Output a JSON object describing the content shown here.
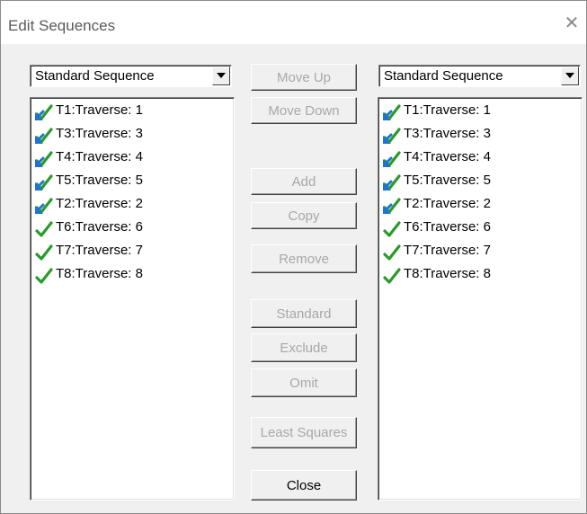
{
  "window": {
    "title": "Edit Sequences"
  },
  "left_combo": {
    "value": "Standard Sequence"
  },
  "right_combo": {
    "value": "Standard Sequence"
  },
  "left_list": [
    {
      "label": "T1:Traverse: 1",
      "icon": "blue-arrow-check-icon"
    },
    {
      "label": "T3:Traverse: 3",
      "icon": "blue-arrow-check-icon"
    },
    {
      "label": "T4:Traverse: 4",
      "icon": "blue-arrow-check-icon"
    },
    {
      "label": "T5:Traverse: 5",
      "icon": "blue-arrow-check-icon"
    },
    {
      "label": "T2:Traverse: 2",
      "icon": "blue-arrow-check-icon"
    },
    {
      "label": "T6:Traverse: 6",
      "icon": "green-check-icon"
    },
    {
      "label": "T7:Traverse: 7",
      "icon": "green-check-icon"
    },
    {
      "label": "T8:Traverse: 8",
      "icon": "green-check-icon"
    }
  ],
  "right_list": [
    {
      "label": "T1:Traverse: 1",
      "icon": "blue-arrow-check-icon"
    },
    {
      "label": "T3:Traverse: 3",
      "icon": "blue-arrow-check-icon"
    },
    {
      "label": "T4:Traverse: 4",
      "icon": "blue-arrow-check-icon"
    },
    {
      "label": "T5:Traverse: 5",
      "icon": "blue-arrow-check-icon"
    },
    {
      "label": "T2:Traverse: 2",
      "icon": "blue-arrow-check-icon"
    },
    {
      "label": "T6:Traverse: 6",
      "icon": "green-check-icon"
    },
    {
      "label": "T7:Traverse: 7",
      "icon": "green-check-icon"
    },
    {
      "label": "T8:Traverse: 8",
      "icon": "green-check-icon"
    }
  ],
  "buttons": {
    "move_up": "Move Up",
    "move_down": "Move Down",
    "add": "Add",
    "copy": "Copy",
    "remove": "Remove",
    "standard": "Standard",
    "exclude": "Exclude",
    "omit": "Omit",
    "least_squares": "Least Squares",
    "close": "Close"
  },
  "colors": {
    "check_green": "#2a9a2a",
    "arrow_blue": "#1e73d8",
    "disabled_text": "#a8a8a8"
  }
}
